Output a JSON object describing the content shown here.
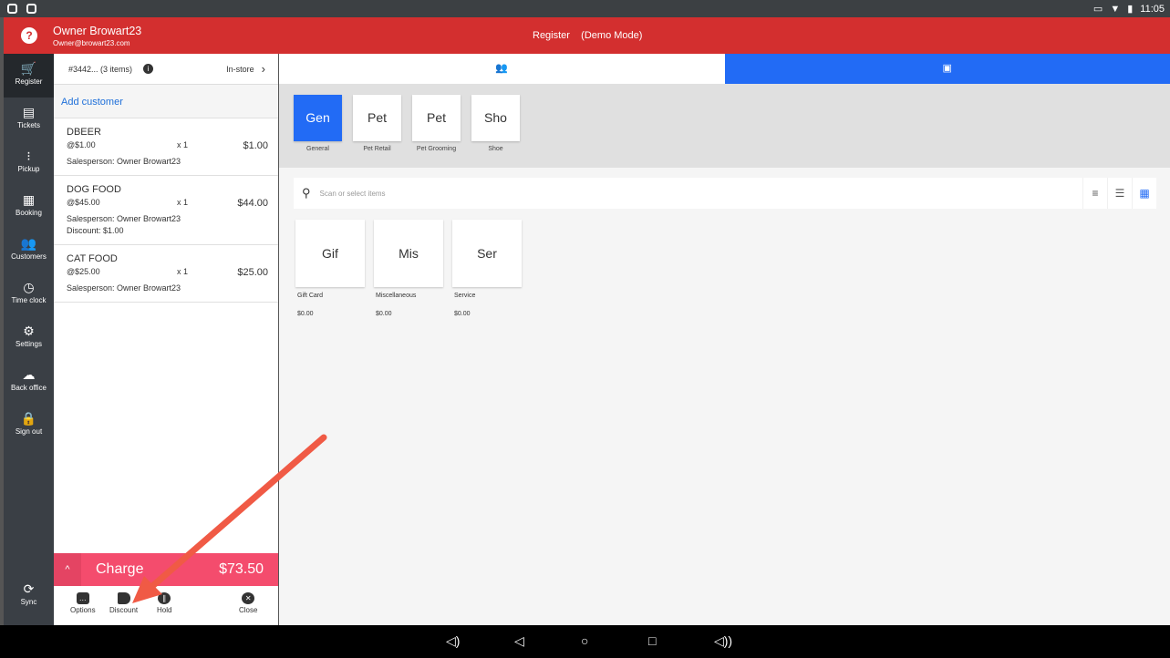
{
  "status": {
    "time": "11:05"
  },
  "header": {
    "owner": "Owner Browart23",
    "email": "Owner@browart23.com",
    "title": "Register    (Demo Mode)"
  },
  "sidebar": [
    {
      "label": "Register",
      "icon": "🛒"
    },
    {
      "label": "Tickets",
      "icon": "▤"
    },
    {
      "label": "Pickup",
      "icon": "⁝"
    },
    {
      "label": "Booking",
      "icon": "▦"
    },
    {
      "label": "Customers",
      "icon": "👥"
    },
    {
      "label": "Time clock",
      "icon": "◷"
    },
    {
      "label": "Settings",
      "icon": "⚙"
    },
    {
      "label": "Back office",
      "icon": "☁"
    },
    {
      "label": "Sign out",
      "icon": "🔒"
    }
  ],
  "sync": {
    "label": "Sync",
    "icon": "⟳"
  },
  "order": {
    "id": "#3442... (3 items)",
    "mode": "In-store",
    "add_customer": "Add customer",
    "items": [
      {
        "name": "DBEER",
        "price": "@$1.00",
        "qty": "x  1",
        "total": "$1.00",
        "salesperson": "Salesperson: Owner Browart23"
      },
      {
        "name": "DOG FOOD",
        "price": "@$45.00",
        "qty": "x  1",
        "total": "$44.00",
        "salesperson": "Salesperson: Owner Browart23",
        "discount": "Discount: $1.00"
      },
      {
        "name": "CAT FOOD",
        "price": "@$25.00",
        "qty": "x  1",
        "total": "$25.00",
        "salesperson": "Salesperson: Owner Browart23"
      }
    ]
  },
  "charge": {
    "label": "Charge",
    "amount": "$73.50"
  },
  "actions": {
    "options": "Options",
    "discount": "Discount",
    "hold": "Hold",
    "close": "Close"
  },
  "categories": [
    {
      "short": "Gen",
      "name": "General"
    },
    {
      "short": "Pet",
      "name": "Pet Retail"
    },
    {
      "short": "Pet",
      "name": "Pet Grooming"
    },
    {
      "short": "Sho",
      "name": "Shoe"
    }
  ],
  "search": {
    "placeholder": "Scan or select items"
  },
  "products": [
    {
      "short": "Gif",
      "name": "Gift Card",
      "price": "$0.00"
    },
    {
      "short": "Mis",
      "name": "Miscellaneous",
      "price": "$0.00"
    },
    {
      "short": "Ser",
      "name": "Service",
      "price": "$0.00"
    }
  ],
  "colors": {
    "header": "#d32f2f",
    "accent": "#226bf5",
    "charge": "#f44c6d"
  }
}
